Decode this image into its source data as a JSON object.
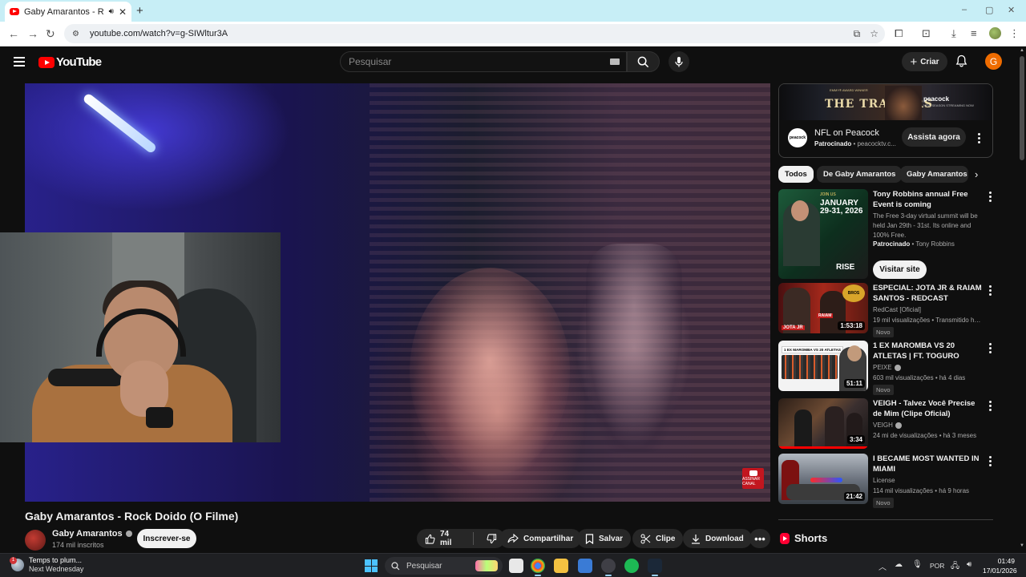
{
  "browser": {
    "tab_title": "Gaby Amarantos - Rock Do",
    "tab_audio_icon": "speaker-icon",
    "url": "youtube.com/watch?v=g-SIWltur3A",
    "window_controls": [
      "–",
      "▢",
      "✕"
    ]
  },
  "youtube_header": {
    "logo_text": "YouTube",
    "search_placeholder": "Pesquisar",
    "create_label": "Criar",
    "avatar_letter": "G"
  },
  "player": {
    "watermark_text": "ASSINAR CANAL"
  },
  "video": {
    "title": "Gaby Amarantos - Rock Doido (O Filme)",
    "channel_name": "Gaby Amarantos",
    "subscribers": "174 mil inscritos",
    "subscribe_label": "Inscrever-se",
    "like_count": "74 mil",
    "share_label": "Compartilhar",
    "save_label": "Salvar",
    "clip_label": "Clipe",
    "download_label": "Download"
  },
  "sidebar_ad": {
    "banner_award": "EMMY® AWARD WINNER",
    "banner_title": "THE TRAITORS",
    "banner_brand": "peacock",
    "banner_note": "NEW SEASON STREAMING NOW",
    "logo_text": "peacock",
    "title": "NFL on Peacock",
    "sponsored_label": "Patrocinado",
    "domain": "peacocktv.c...",
    "cta_label": "Assista agora"
  },
  "chips": [
    "Todos",
    "De Gaby Amarantos",
    "Gaby Amarantos"
  ],
  "recommendations": [
    {
      "title": "Tony Robbins annual Free Event is coming",
      "description": "The Free 3-day virtual summit will be held Jan 29th - 31st. Its online and 100% Free.",
      "sponsored_label": "Patrocinado",
      "sponsor": "Tony Robbins",
      "cta_label": "Visitar site",
      "thumb_small": "JOIN US",
      "thumb_text": "JANUARY 29-31, 2026",
      "thumb_brand": "RISE"
    },
    {
      "title": "ESPECIAL: JOTA JR & RAIAM SANTOS - REDCAST",
      "channel": "RedCast [Oficial]",
      "meta": "19 mil visualizações • Transmitido há 8 ...",
      "badge": "Novo",
      "duration": "1:53:18",
      "thumb_logo": "BROS",
      "thumb_name_1": "JOTA JR",
      "thumb_name_2": "RAIAM"
    },
    {
      "title": "1 EX MAROMBA VS 20 ATLETAS | FT. TOGURO",
      "channel": "PEIXE",
      "meta": "603 mil visualizações • há 4 dias",
      "badge": "Novo",
      "duration": "51:11",
      "thumb_text": "1 EX MAROMBA VS 20 ATLETAS"
    },
    {
      "title": "VEIGH - Talvez Você Precise de Mim (Clipe Oficial)",
      "channel": "VEIGH",
      "meta": "24 mi de visualizações • há 3 meses",
      "duration": "3:34"
    },
    {
      "title": "I BECAME MOST WANTED IN MIAMI",
      "channel": "License",
      "meta": "114 mil visualizações • há 9 horas",
      "badge": "Novo",
      "duration": "21:42"
    }
  ],
  "shorts_label": "Shorts",
  "taskbar": {
    "weather_line1": "Temps to plum...",
    "weather_line2": "Next Wednesday",
    "weather_badge": "1",
    "search_placeholder": "Pesquisar",
    "language": "POR",
    "time": "01:49",
    "date": "17/01/2026"
  },
  "colors": {
    "yt_red": "#ff0000",
    "bg": "#0f0f0f",
    "chip_bg": "#272727",
    "avatar": "#ef6c00",
    "tabstrip": "#c7eef6"
  }
}
